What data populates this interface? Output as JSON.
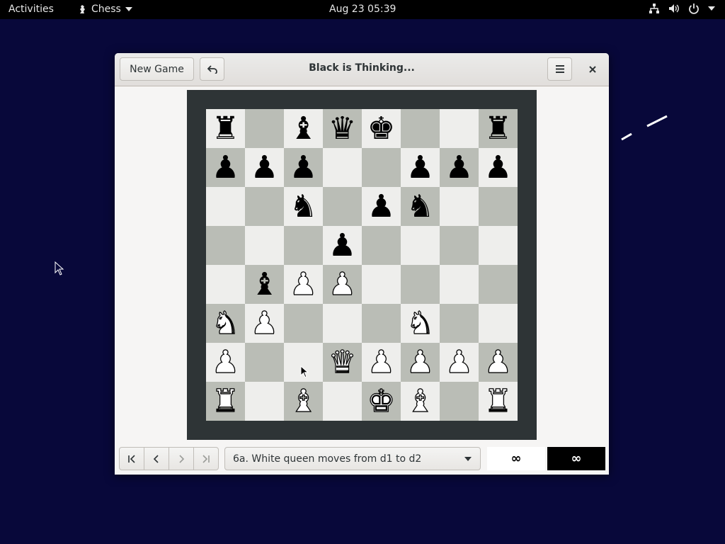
{
  "topbar": {
    "activities": "Activities",
    "app_name": "Chess",
    "clock": "Aug 23  05:39",
    "tray_icons": [
      "network-icon",
      "volume-icon",
      "power-icon",
      "chevron-down-icon"
    ]
  },
  "window": {
    "title": "Black is Thinking...",
    "new_game_label": "New Game",
    "undo_icon": "undo-icon",
    "menu_icon": "hamburger-menu-icon",
    "close_icon": "close-icon"
  },
  "board": {
    "ranks": [
      [
        "br",
        "",
        "bb",
        "bq",
        "bk",
        "",
        "",
        "br"
      ],
      [
        "bp",
        "bp",
        "bp",
        "",
        "",
        "bp",
        "bp",
        "bp"
      ],
      [
        "",
        "",
        "bn",
        "",
        "bp",
        "bn",
        "",
        ""
      ],
      [
        "",
        "",
        "",
        "bp",
        "",
        "",
        "",
        ""
      ],
      [
        "",
        "bb",
        "wp",
        "wp",
        "",
        "",
        "",
        ""
      ],
      [
        "wn",
        "wp",
        "",
        "",
        "",
        "wn",
        "",
        ""
      ],
      [
        "wp",
        "",
        "",
        "wq",
        "wp",
        "wp",
        "wp",
        "wp"
      ],
      [
        "wr",
        "",
        "wb",
        "",
        "wk",
        "wb",
        "",
        "wr"
      ]
    ],
    "colors": {
      "light": "#eeeeec",
      "dark": "#babdb6",
      "frame": "#2e3436"
    }
  },
  "history": {
    "first_icon": "first-move-icon",
    "prev_icon": "previous-move-icon",
    "next_icon": "next-move-icon",
    "last_icon": "last-move-icon",
    "current_move": "6a. White queen moves from d1 to d2"
  },
  "clocks": {
    "white": "∞",
    "black": "∞"
  }
}
